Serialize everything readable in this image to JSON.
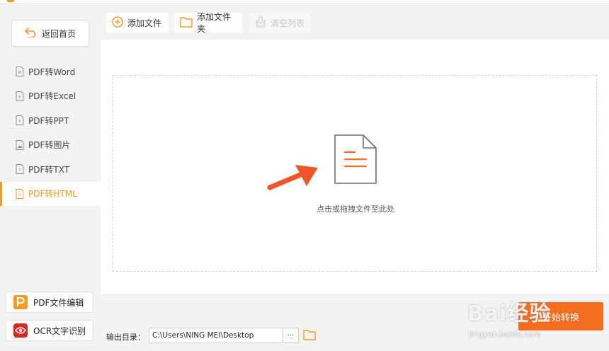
{
  "sidebar": {
    "back_label": "返回首页",
    "items": [
      {
        "label": "PDF转Word",
        "icon": "W"
      },
      {
        "label": "PDF转Excel",
        "icon": "E"
      },
      {
        "label": "PDF转PPT",
        "icon": "P"
      },
      {
        "label": "PDF转图片",
        "icon": "image"
      },
      {
        "label": "PDF转TXT",
        "icon": "T"
      },
      {
        "label": "PDF转HTML",
        "icon": "H",
        "active": true
      }
    ],
    "pdf_edit_label": "PDF文件编辑",
    "ocr_label": "OCR文字识别"
  },
  "toolbar": {
    "add_file_label": "添加文件",
    "add_folder_label": "添加文件夹",
    "clear_list_label": "清空列表"
  },
  "drop_zone": {
    "hint": "点击或拖拽文件至此处"
  },
  "footer": {
    "output_label": "输出目录：",
    "output_path": "C:\\Users\\NING MEI\\Desktop",
    "browse_label": "···",
    "convert_label": "开始转换"
  },
  "watermark": {
    "brand": "Bai经验",
    "url": "jingyan.baidu.com"
  },
  "colors": {
    "accent": "#f59a23",
    "convert": "#f56e1f",
    "arrow": "#f0552a"
  }
}
